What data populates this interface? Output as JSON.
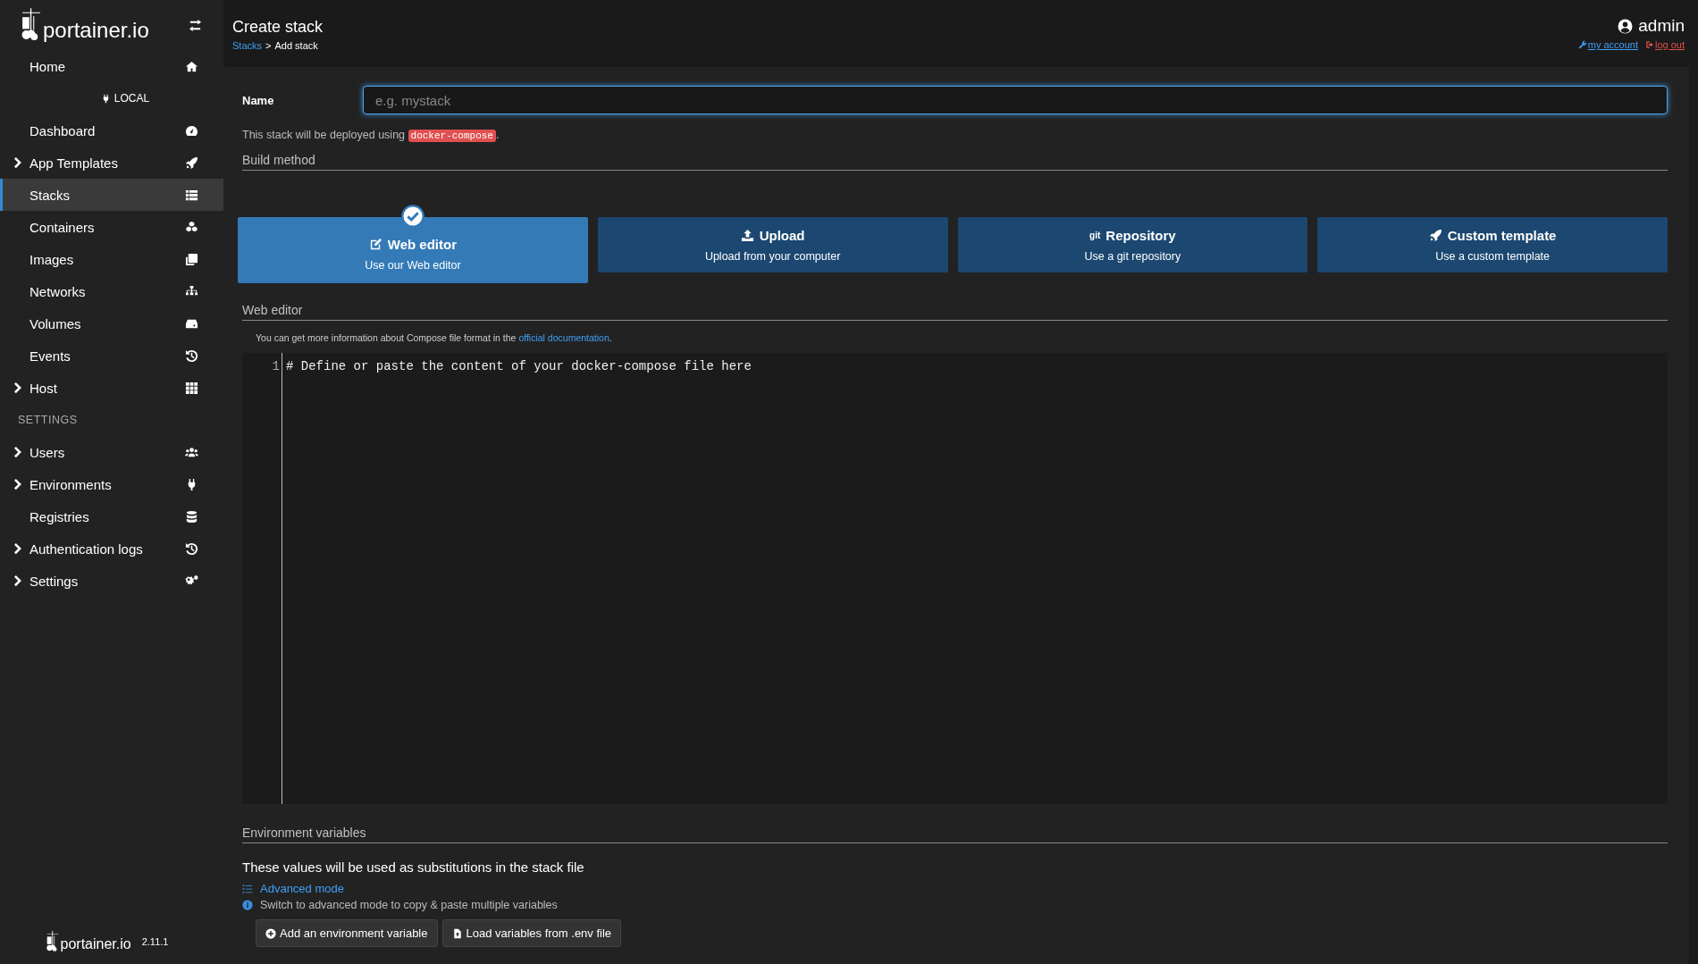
{
  "sidebar": {
    "logo": "portainer.io",
    "items": [
      {
        "label": "Home",
        "expandable": false,
        "selected": false
      },
      {
        "kind": "section",
        "label": "LOCAL"
      },
      {
        "label": "Dashboard",
        "expandable": false,
        "selected": false
      },
      {
        "label": "App Templates",
        "expandable": true,
        "selected": false
      },
      {
        "label": "Stacks",
        "expandable": false,
        "selected": true
      },
      {
        "label": "Containers",
        "expandable": false,
        "selected": false
      },
      {
        "label": "Images",
        "expandable": false,
        "selected": false
      },
      {
        "label": "Networks",
        "expandable": false,
        "selected": false
      },
      {
        "label": "Volumes",
        "expandable": false,
        "selected": false
      },
      {
        "label": "Events",
        "expandable": false,
        "selected": false
      },
      {
        "label": "Host",
        "expandable": true,
        "selected": false
      },
      {
        "kind": "heading",
        "label": "SETTINGS"
      },
      {
        "label": "Users",
        "expandable": true,
        "selected": false
      },
      {
        "label": "Environments",
        "expandable": true,
        "selected": false
      },
      {
        "label": "Registries",
        "expandable": false,
        "selected": false
      },
      {
        "label": "Authentication logs",
        "expandable": true,
        "selected": false
      },
      {
        "label": "Settings",
        "expandable": true,
        "selected": false
      }
    ],
    "footer": {
      "logo": "portainer.io",
      "version": "2.11.1"
    }
  },
  "header": {
    "title": "Create stack",
    "breadcrumb": {
      "link": "Stacks",
      "separator": ">",
      "current": "Add stack"
    },
    "user": "admin",
    "my_account": "my account",
    "log_out": "log out"
  },
  "form": {
    "name_label": "Name",
    "name_placeholder": "e.g. mystack",
    "deploy_note": {
      "text": "This stack will be deployed using",
      "code": "docker-compose",
      "end": "."
    },
    "build_method_title": "Build method",
    "build_methods": [
      {
        "title": "Web editor",
        "subtitle": "Use our Web editor",
        "selected": true
      },
      {
        "title": "Upload",
        "subtitle": "Upload from your computer",
        "selected": false
      },
      {
        "title": "Repository",
        "subtitle": "Use a git repository",
        "selected": false
      },
      {
        "title": "Custom template",
        "subtitle": "Use a custom template",
        "selected": false
      }
    ],
    "git_icon_text": "git",
    "editor_title": "Web editor",
    "editor_note": {
      "text": "You can get more information about Compose file format in the",
      "link": "official documentation",
      "end": "."
    },
    "editor_lines": [
      {
        "number": "1",
        "text": "# Define or paste the content of your docker-compose file here"
      }
    ],
    "env_title": "Environment variables",
    "env_description": "These values will be used as substitutions in the stack file",
    "advanced_mode": "Advanced mode",
    "advanced_hint": "Switch to advanced mode to copy & paste multiple variables",
    "buttons": [
      {
        "label": "Add an environment variable"
      },
      {
        "label": "Load variables from .env file"
      }
    ]
  }
}
